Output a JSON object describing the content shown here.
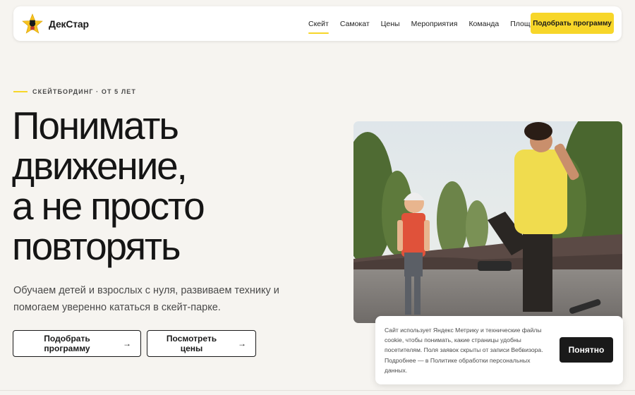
{
  "header": {
    "brand": "ДекСтар",
    "nav": [
      {
        "label": "Скейт",
        "active": true
      },
      {
        "label": "Самокат",
        "active": false
      },
      {
        "label": "Цены",
        "active": false
      },
      {
        "label": "Мероприятия",
        "active": false
      },
      {
        "label": "Команда",
        "active": false
      },
      {
        "label": "Площадки",
        "active": false
      }
    ],
    "cta": "Подобрать программу"
  },
  "hero": {
    "eyebrow": "СКЕЙТБОРДИНГ · ОТ 5 ЛЕТ",
    "title_lines": [
      "Понимать",
      "движение,",
      "а не просто",
      "повторять"
    ],
    "subtitle": "Обучаем детей и взрослых с нуля, развиваем технику и помогаем уверенно кататься в скейт-парке.",
    "buttons": [
      {
        "label": "Подобрать программу",
        "arrow": "→"
      },
      {
        "label": "Посмотреть цены",
        "arrow": "→"
      }
    ]
  },
  "cookie": {
    "text": "Сайт использует Яндекс Метрику и технические файлы cookie, чтобы понимать, какие страницы удобны посетителям. Поля заявок скрыты от записи Вебвизора. Подробнее — в Политике обработки персональных данных.",
    "button": "Понятно"
  },
  "colors": {
    "accent": "#f7d629",
    "background": "#f6f4f0",
    "text": "#1a1a1a"
  },
  "icons": {
    "logo": "star-skater-logo",
    "photo": "skatepark-coach-kid-photo"
  }
}
